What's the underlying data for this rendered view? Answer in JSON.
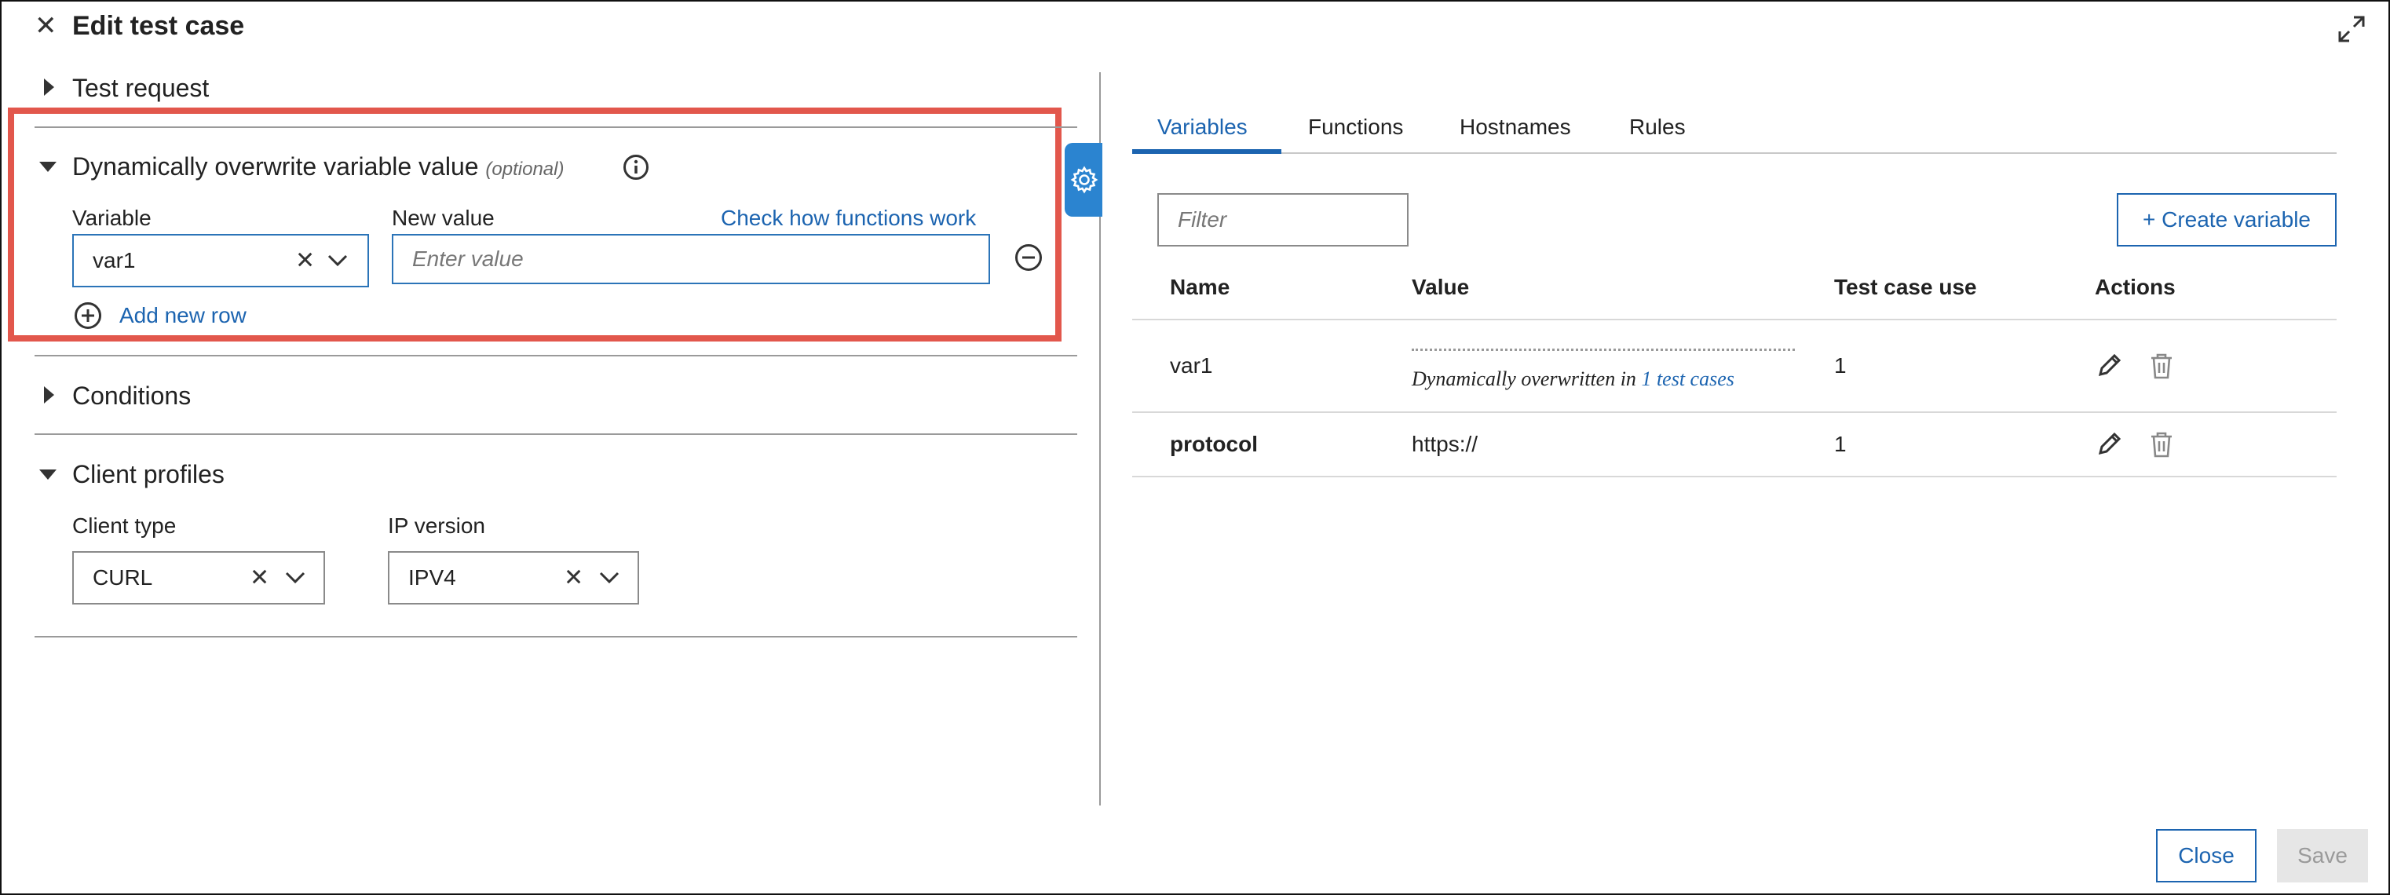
{
  "dialog": {
    "title": "Edit test case",
    "close_icon": "close-icon",
    "expand_icon": "expand-icon"
  },
  "left": {
    "test_request": {
      "label": "Test request",
      "collapsed": true
    },
    "overwrite": {
      "label": "Dynamically overwrite variable value",
      "optional": "(optional)",
      "info_icon": "info-icon",
      "variable_label": "Variable",
      "variable_value": "var1",
      "new_value_label": "New value",
      "new_value_placeholder": "Enter value",
      "functions_link": "Check how functions work",
      "add_row": "Add new row",
      "highlight_color": "#e2574c"
    },
    "conditions": {
      "label": "Conditions",
      "collapsed": true
    },
    "client_profiles": {
      "label": "Client profiles",
      "client_type_label": "Client type",
      "client_type_value": "CURL",
      "ip_version_label": "IP version",
      "ip_version_value": "IPV4"
    }
  },
  "right": {
    "tabs": [
      {
        "label": "Variables",
        "active": true
      },
      {
        "label": "Functions",
        "active": false
      },
      {
        "label": "Hostnames",
        "active": false
      },
      {
        "label": "Rules",
        "active": false
      }
    ],
    "filter_placeholder": "Filter",
    "create_button": "+ Create variable",
    "table": {
      "headers": [
        "Name",
        "Value",
        "Test case use",
        "Actions"
      ],
      "rows": [
        {
          "name": "var1",
          "value_prefix": "Dynamically overwritten in ",
          "value_link": "1 test cases",
          "use": "1"
        },
        {
          "name": "protocol",
          "value": "https://",
          "use": "1"
        }
      ]
    }
  },
  "footer": {
    "close": "Close",
    "save": "Save"
  },
  "colors": {
    "accent": "#1c64b0",
    "highlight": "#e2574c",
    "settings_tab": "#2b84d0"
  }
}
